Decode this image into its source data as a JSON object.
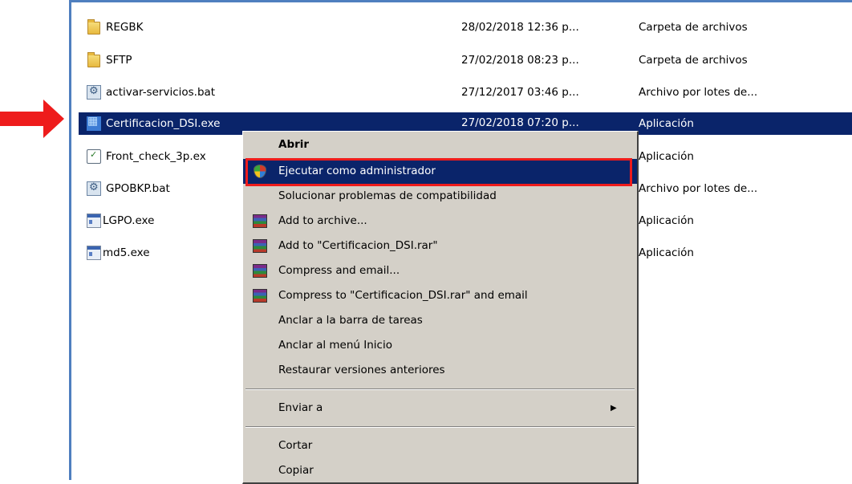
{
  "files": [
    {
      "name": "REGBK",
      "date": "28/02/2018 12:36 p...",
      "type": "Carpeta de archivos",
      "icon": "folder-icon",
      "selected": false
    },
    {
      "name": "SFTP",
      "date": "27/02/2018 08:23 p...",
      "type": "Carpeta de archivos",
      "icon": "folder-icon",
      "selected": false
    },
    {
      "name": "activar-servicios.bat",
      "date": "27/12/2017 03:46 p...",
      "type": "Archivo por lotes de...",
      "icon": "batch-file-icon",
      "selected": false
    },
    {
      "name": "Certificacion_DSI.exe",
      "date": "27/02/2018 07:20 p...",
      "type": "Aplicación",
      "icon": "application-icon",
      "selected": true
    },
    {
      "name": "Front_check_3p.ex",
      "date": "",
      "type": "Aplicación",
      "icon": "checklist-app-icon",
      "selected": false
    },
    {
      "name": "GPOBKP.bat",
      "date": "",
      "type": "Archivo por lotes de...",
      "icon": "batch-file-icon",
      "selected": false
    },
    {
      "name": "LGPO.exe",
      "date": "",
      "type": "Aplicación",
      "icon": "application-icon",
      "selected": false
    },
    {
      "name": "md5.exe",
      "date": "",
      "type": "Aplicación",
      "icon": "application-icon",
      "selected": false
    }
  ],
  "context_menu": {
    "items": [
      {
        "label": "Abrir",
        "bold": true,
        "icon": ""
      },
      {
        "label": "Ejecutar como administrador",
        "highlighted": true,
        "icon": "uac-shield-icon"
      },
      {
        "label": "Solucionar problemas de compatibilidad",
        "icon": ""
      },
      {
        "label": "Add to archive...",
        "icon": "winrar-icon"
      },
      {
        "label": "Add to \"Certificacion_DSI.rar\"",
        "icon": "winrar-icon"
      },
      {
        "label": "Compress and email...",
        "icon": "winrar-icon"
      },
      {
        "label": "Compress to \"Certificacion_DSI.rar\" and email",
        "icon": "winrar-icon"
      },
      {
        "label": "Anclar a la barra de tareas",
        "icon": ""
      },
      {
        "label": "Anclar al menú Inicio",
        "icon": ""
      },
      {
        "label": "Restaurar versiones anteriores",
        "icon": ""
      },
      {
        "label": "Enviar a",
        "submenu": true,
        "icon": ""
      },
      {
        "label": "Cortar",
        "icon": ""
      },
      {
        "label": "Copiar",
        "icon": ""
      }
    ]
  },
  "annotations": {
    "arrow_color": "#ee1c1c",
    "highlight_box_color": "#ee1c1c"
  },
  "colors": {
    "selection": "#0a246a",
    "menu_bg": "#d4d0c8",
    "frame": "#4f7fbf"
  }
}
